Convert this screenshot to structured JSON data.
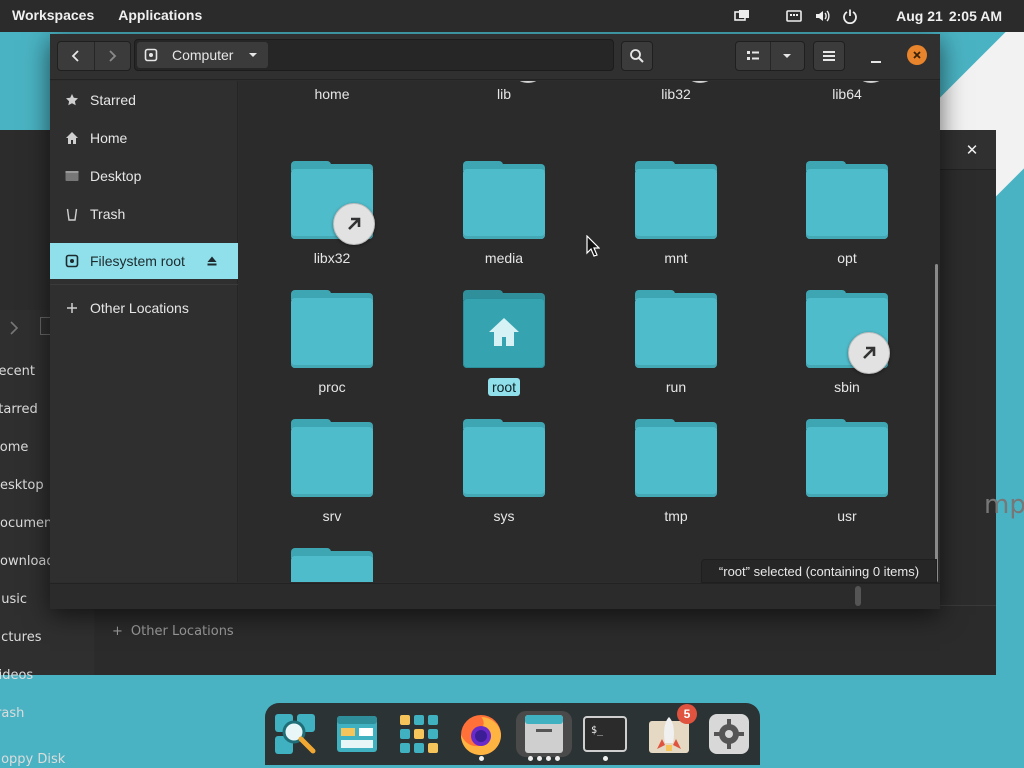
{
  "topbar": {
    "workspaces": "Workspaces",
    "applications": "Applications",
    "date": "Aug 21",
    "time": "2:05 AM",
    "indicators": [
      "screen-share-icon",
      "keyboard-icon",
      "volume-icon",
      "power-icon"
    ]
  },
  "background_window": {
    "sidebar_items": [
      "Recent",
      "Starred",
      "Home",
      "Desktop",
      "Documents",
      "Downloads",
      "Music",
      "Pictures",
      "Videos",
      "Trash",
      "Floppy Disk"
    ],
    "other_locations": "Other Locations",
    "empty_hint": "mpt"
  },
  "window": {
    "path_location": "Computer",
    "status": "“root” selected  (containing 0 items)"
  },
  "sidebar": {
    "items": [
      {
        "label": "Starred",
        "icon": "star-icon"
      },
      {
        "label": "Home",
        "icon": "home-icon"
      },
      {
        "label": "Desktop",
        "icon": "desktop-icon"
      },
      {
        "label": "Trash",
        "icon": "trash-icon"
      },
      {
        "label": "Filesystem root",
        "icon": "drive-icon",
        "selected": true
      },
      {
        "label": "Other Locations",
        "icon": "plus-icon"
      }
    ]
  },
  "files": {
    "top_row_partial": [
      "home",
      "lib",
      "lib32",
      "lib64"
    ],
    "items": [
      {
        "name": "libx32",
        "symlink": true
      },
      {
        "name": "media"
      },
      {
        "name": "mnt"
      },
      {
        "name": "opt"
      },
      {
        "name": "proc"
      },
      {
        "name": "root",
        "selected": true
      },
      {
        "name": "run"
      },
      {
        "name": "sbin",
        "symlink": true
      },
      {
        "name": "srv"
      },
      {
        "name": "sys"
      },
      {
        "name": "tmp"
      },
      {
        "name": "usr"
      },
      {
        "name": ""
      }
    ]
  },
  "dock": {
    "items": [
      "search-app-icon",
      "files-app-icon",
      "app-grid-icon",
      "firefox-icon",
      "file-manager-icon",
      "terminal-icon",
      "shop-icon",
      "settings-icon"
    ],
    "badge_count": "5"
  },
  "colors": {
    "accent": "#8fe0ea",
    "folder": "#4fbccb",
    "close_button": "#e8842b",
    "wallpaper": "#4ab3c3"
  }
}
